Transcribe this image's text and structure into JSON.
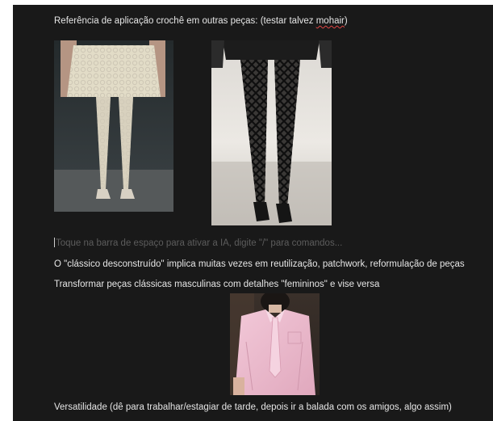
{
  "note": {
    "line1_prefix": "Referência de aplicação crochê em outras peças: (testar talvez ",
    "line1_flagged_word": "mohair",
    "line1_suffix": ")",
    "placeholder": "Toque na barra de espaço para ativar a IA, digite \"/\" para comandos...",
    "line2": "O \"clássico desconstruído\" implica muitas vezes em reutilização, patchwork, reformulação de peças",
    "line3": "Transformar peças clássicas masculinas com detalhes \"femininos\" e vise versa",
    "line4": "Versatilidade (dê para trabalhar/estagiar de tarde, depois ir a balada com os amigos, algo assim)"
  },
  "images": [
    {
      "name": "cream-crochet-skirt-and-thigh-high-stockings-photo"
    },
    {
      "name": "black-crochet-lattice-tights-runway-photo"
    },
    {
      "name": "pink-shirt-and-tie-photo"
    }
  ],
  "colors": {
    "background": "#191919",
    "text": "#e6e6e6",
    "placeholder": "#5c5c5c",
    "spellcheck": "#e04545"
  }
}
